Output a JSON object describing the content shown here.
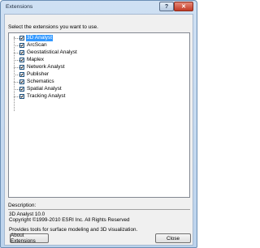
{
  "window": {
    "title": "Extensions"
  },
  "titlebar": {
    "help_label": "?",
    "close_label": "✕"
  },
  "prompt": "Select the extensions you want to use.",
  "extensions": [
    {
      "label": "3D Analyst",
      "checked": true,
      "selected": true
    },
    {
      "label": "ArcScan",
      "checked": true,
      "selected": false
    },
    {
      "label": "Geostatistical Analyst",
      "checked": true,
      "selected": false
    },
    {
      "label": "Maplex",
      "checked": true,
      "selected": false
    },
    {
      "label": "Network Analyst",
      "checked": true,
      "selected": false
    },
    {
      "label": "Publisher",
      "checked": true,
      "selected": false
    },
    {
      "label": "Schematics",
      "checked": true,
      "selected": false
    },
    {
      "label": "Spatial Analyst",
      "checked": true,
      "selected": false
    },
    {
      "label": "Tracking Analyst",
      "checked": true,
      "selected": false
    }
  ],
  "description": {
    "label": "Description:",
    "name": "3D Analyst 10.0",
    "copyright": "Copyright ©1999-2010 ESRI Inc. All Rights Reserved",
    "text": "Provides tools for surface modeling and 3D visualization."
  },
  "buttons": {
    "about": "About Extensions",
    "close": "Close"
  },
  "colors": {
    "selection": "#3399ff",
    "checkbox_border": "#1c5180"
  }
}
